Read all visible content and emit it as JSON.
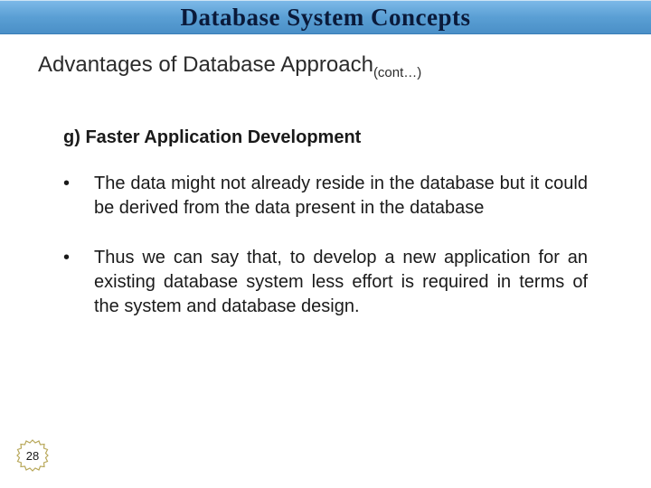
{
  "header": {
    "title": "Database System Concepts"
  },
  "subtitle": {
    "main": "Advantages of Database Approach",
    "suffix": "(cont…)"
  },
  "section": {
    "letter": "g)",
    "heading": "Faster Application Development"
  },
  "bullets": [
    {
      "marker": "•",
      "text": "The data might not already reside in the database but it could be derived from the data present in the database"
    },
    {
      "marker": "•",
      "text": "Thus we can say that, to develop a new application for an existing database system less effort is required in terms of the system and database design."
    }
  ],
  "page": {
    "number": "28"
  }
}
